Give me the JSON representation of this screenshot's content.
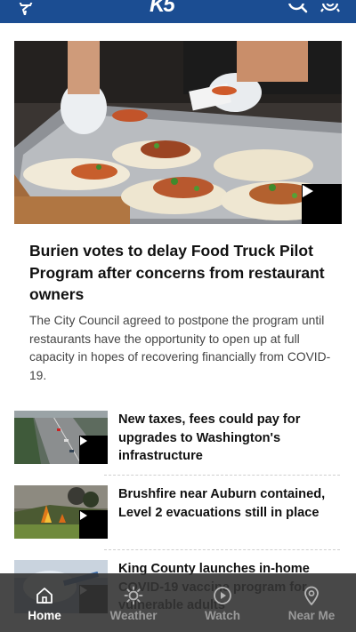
{
  "header": {
    "logo_text": "K5",
    "brand_color": "#1b4d92"
  },
  "hero": {
    "title": "Burien votes to delay Food Truck Pilot Program after concerns from restaurant owners",
    "summary": "The City Council agreed to postpone the program until restaurants have the opportunity to open up at full capacity in hopes of recovering financially from COVID-19."
  },
  "stories": [
    {
      "title": "New taxes, fees could pay for upgrades to Washington's infrastructure"
    },
    {
      "title": "Brushfire near Auburn contained, Level 2 evacuations still in place"
    },
    {
      "title": "King County launches in-home COVID-19 vaccine program for vulnerable adults"
    }
  ],
  "nav": [
    {
      "label": "Home",
      "icon": "home-icon",
      "active": true
    },
    {
      "label": "Weather",
      "icon": "sun-icon",
      "active": false
    },
    {
      "label": "Watch",
      "icon": "play-circle-icon",
      "active": false
    },
    {
      "label": "Near Me",
      "icon": "location-pin-icon",
      "active": false
    }
  ]
}
